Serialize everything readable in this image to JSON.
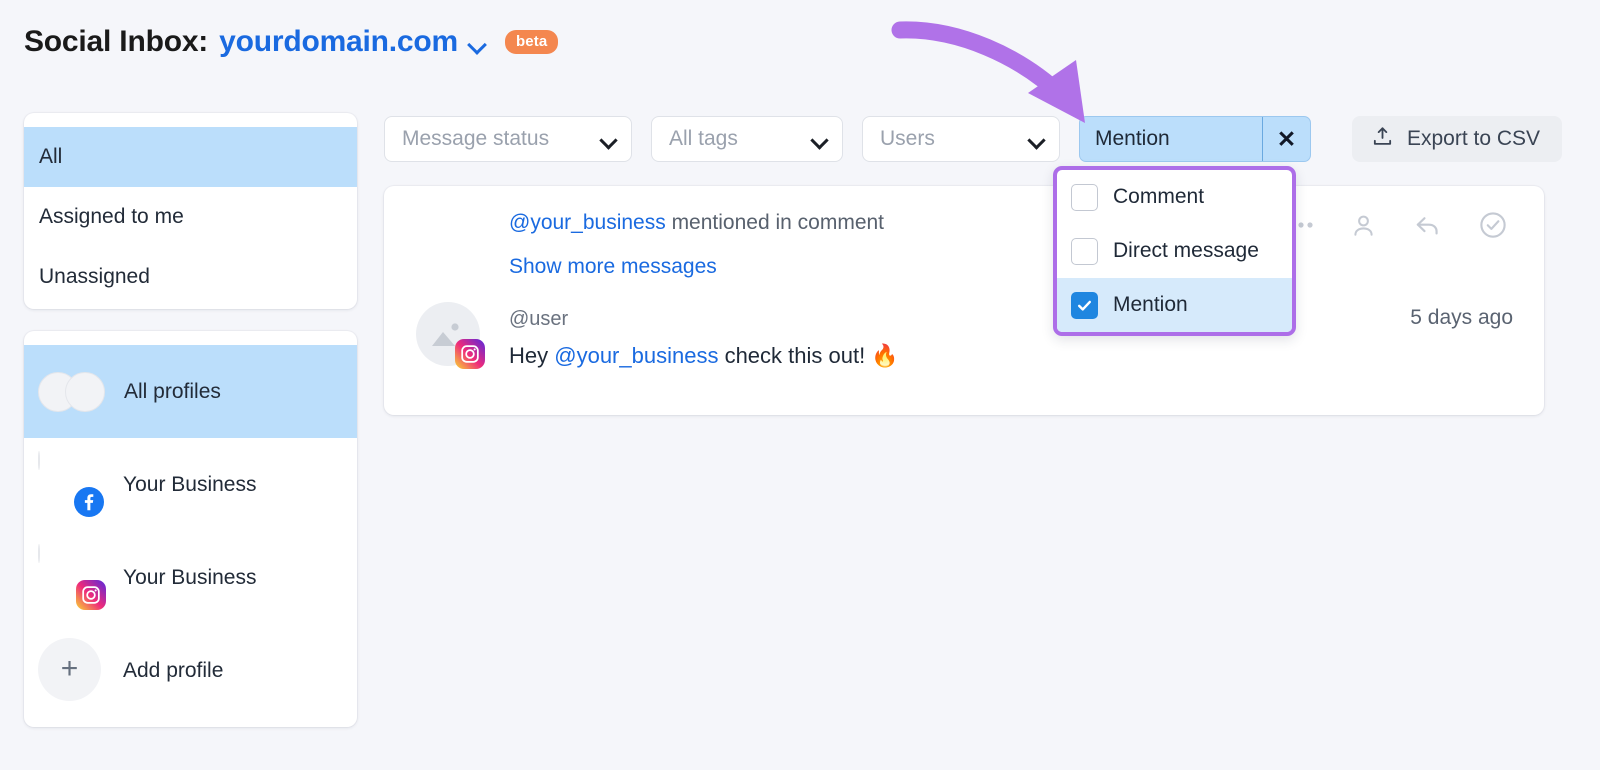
{
  "header": {
    "title": "Social Inbox:",
    "domain": "yourdomain.com",
    "chevron_icon": "chevron-down-icon",
    "badge": "beta",
    "domain_color": "#1a6ae0",
    "badge_color": "#f4874f"
  },
  "sidebar": {
    "filters": [
      {
        "label": "All",
        "active": true
      },
      {
        "label": "Assigned to me",
        "active": false
      },
      {
        "label": "Unassigned",
        "active": false
      }
    ],
    "profiles": [
      {
        "label": "All profiles",
        "network": "all",
        "active": true
      },
      {
        "label": "Your Business",
        "network": "facebook",
        "active": false
      },
      {
        "label": "Your Business",
        "network": "instagram",
        "active": false
      }
    ],
    "add_profile": {
      "label": "Add profile",
      "icon": "plus-icon"
    }
  },
  "toolbar": {
    "selects": [
      {
        "label": "Message status",
        "icon": "chevron-down-icon"
      },
      {
        "label": "All tags",
        "icon": "chevron-down-icon"
      },
      {
        "label": "Users",
        "icon": "chevron-down-icon"
      }
    ],
    "active_chip": {
      "label": "Mention",
      "clear_icon": "close-icon",
      "bg_color": "#bbdefb"
    },
    "export": {
      "label": "Export to CSV",
      "icon": "upload-icon"
    }
  },
  "dropdown": {
    "border_color": "#ad6ee8",
    "options": [
      {
        "label": "Comment",
        "checked": false
      },
      {
        "label": "Direct message",
        "checked": false
      },
      {
        "label": "Mention",
        "checked": true
      }
    ]
  },
  "message": {
    "header_mention": "@your_business",
    "header_rest": " mentioned in comment",
    "show_more": "Show more messages",
    "username": "@user",
    "text_before": "Hey ",
    "text_mention": "@your_business",
    "text_after": " check this out! 🔥",
    "timestamp": "5 days ago",
    "avatar_network": "instagram",
    "actions": [
      {
        "icon": "ellipsis-icon",
        "name": "more-options"
      },
      {
        "icon": "person-icon",
        "name": "assign-user"
      },
      {
        "icon": "reply-icon",
        "name": "reply"
      },
      {
        "icon": "check-circle-icon",
        "name": "mark-done"
      }
    ]
  },
  "annotation": {
    "arrow_color": "#b072e8",
    "icon": "curved-arrow-icon"
  }
}
